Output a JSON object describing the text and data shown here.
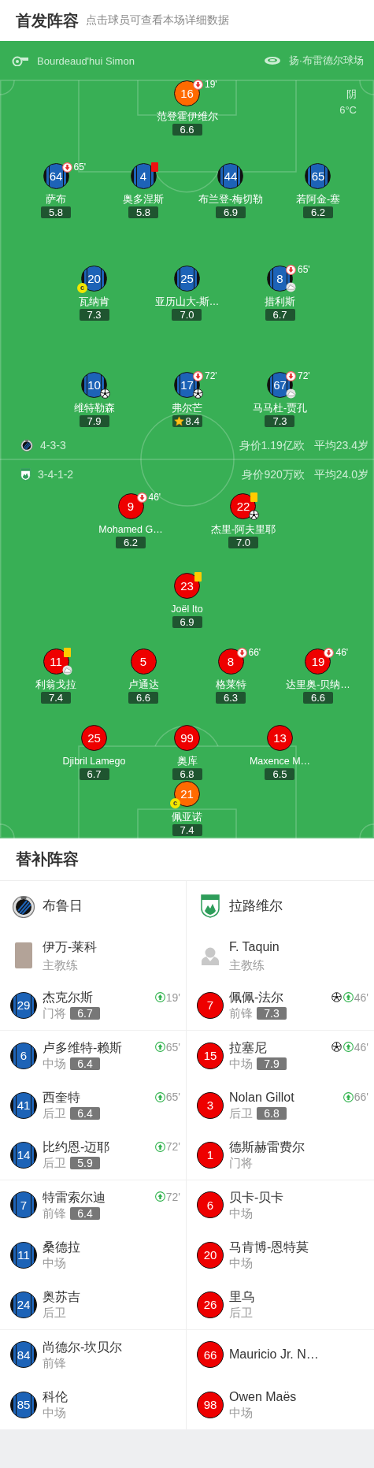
{
  "header": {
    "title": "首发阵容",
    "hint": "点击球员可查看本场详细数据"
  },
  "match_info": {
    "referee": "Bourdeaud'hui Simon",
    "stadium": "扬·布雷德尔球场",
    "weather": "阴",
    "temperature": "6°C"
  },
  "home": {
    "kind": "striped",
    "formation": "4-3-3",
    "market_value": "身价1.19亿欧",
    "average_age": "平均23.4岁",
    "goalkeeper": {
      "number": "16",
      "name": "范登霍伊维尔",
      "rating": "6.6",
      "mvp": false,
      "events": [
        {
          "kind": "sub_off",
          "minute": "19'"
        }
      ]
    },
    "lines": [
      [
        {
          "number": "64",
          "name": "萨布",
          "rating": "5.8",
          "mvp": false,
          "events": [
            {
              "kind": "sub_off",
              "minute": "65'"
            }
          ]
        },
        {
          "number": "4",
          "name": "奥多涅斯",
          "rating": "5.8",
          "mvp": false,
          "events": [
            {
              "kind": "red_card"
            }
          ]
        },
        {
          "number": "44",
          "name": "布兰登-梅切勒",
          "rating": "6.9",
          "mvp": false
        },
        {
          "number": "65",
          "name": "若阿金-塞",
          "rating": "6.2",
          "mvp": false
        }
      ],
      [
        {
          "number": "20",
          "name": "瓦纳肯",
          "rating": "7.3",
          "mvp": false,
          "events": [
            {
              "kind": "captain",
              "label": "c"
            }
          ]
        },
        {
          "number": "25",
          "name": "亚历山大-斯…",
          "rating": "7.0",
          "mvp": false
        },
        {
          "number": "8",
          "name": "措利斯",
          "rating": "6.7",
          "mvp": false,
          "events": [
            {
              "kind": "sub_off",
              "minute": "65'"
            },
            {
              "kind": "assist"
            }
          ]
        }
      ],
      [
        {
          "number": "10",
          "name": "维特勒森",
          "rating": "7.9",
          "mvp": false,
          "events": [
            {
              "kind": "goal"
            }
          ]
        },
        {
          "number": "17",
          "name": "弗尔芒",
          "rating": "8.4",
          "mvp": true,
          "events": [
            {
              "kind": "sub_off",
              "minute": "72'"
            },
            {
              "kind": "goal"
            }
          ]
        },
        {
          "number": "67",
          "name": "马马杜-贾孔",
          "rating": "7.3",
          "mvp": false,
          "events": [
            {
              "kind": "sub_off",
              "minute": "72'"
            },
            {
              "kind": "assist"
            }
          ]
        }
      ]
    ]
  },
  "away": {
    "kind": "solid",
    "formation": "3-4-1-2",
    "market_value": "身价920万欧",
    "average_age": "平均24.0岁",
    "lines": [
      [
        {
          "number": "9",
          "name": "Mohamed G…",
          "rating": "6.2",
          "mvp": false,
          "events": [
            {
              "kind": "sub_off",
              "minute": "46'"
            }
          ]
        },
        {
          "number": "22",
          "name": "杰里-阿夫里耶",
          "rating": "7.0",
          "mvp": false,
          "events": [
            {
              "kind": "yellow_card"
            },
            {
              "kind": "goal"
            }
          ]
        }
      ],
      [
        {
          "number": "23",
          "name": "Joël Ito",
          "rating": "6.9",
          "mvp": false,
          "events": [
            {
              "kind": "yellow_card"
            }
          ]
        }
      ],
      [
        {
          "number": "11",
          "name": "利翁戈拉",
          "rating": "7.4",
          "mvp": false,
          "events": [
            {
              "kind": "yellow_card"
            },
            {
              "kind": "assist"
            }
          ]
        },
        {
          "number": "5",
          "name": "卢通达",
          "rating": "6.6",
          "mvp": false
        },
        {
          "number": "8",
          "name": "格莱特",
          "rating": "6.3",
          "mvp": false,
          "events": [
            {
              "kind": "sub_off",
              "minute": "66'"
            }
          ]
        },
        {
          "number": "19",
          "name": "达里奥-贝纳…",
          "rating": "6.6",
          "mvp": false,
          "events": [
            {
              "kind": "sub_off",
              "minute": "46'"
            }
          ]
        }
      ],
      [
        {
          "number": "25",
          "name": "Djibril Lamego",
          "rating": "6.7",
          "mvp": false
        },
        {
          "number": "99",
          "name": "奥库",
          "rating": "6.8",
          "mvp": false
        },
        {
          "number": "13",
          "name": "Maxence M…",
          "rating": "6.5",
          "mvp": false
        }
      ]
    ],
    "goalkeeper": {
      "number": "21",
      "name": "佩亚诺",
      "rating": "7.4",
      "mvp": false,
      "events": [
        {
          "kind": "captain",
          "label": "c"
        }
      ]
    }
  },
  "bench": {
    "title": "替补阵容",
    "teams": [
      {
        "name": "布鲁日",
        "kind": "striped",
        "coach": {
          "kind": "photo",
          "name": "伊万-莱科",
          "role": "主教练"
        },
        "subs": [
          {
            "number": "29",
            "name": "杰克尔斯",
            "position": "门将",
            "rating": "6.7",
            "events": [
              {
                "kind": "sub_on",
                "minute": "19'"
              }
            ]
          },
          {
            "number": "6",
            "name": "卢多维特-赖斯",
            "position": "中场",
            "rating": "6.4",
            "events": [
              {
                "kind": "sub_on",
                "minute": "65'"
              }
            ]
          },
          {
            "number": "41",
            "name": "西奎特",
            "position": "后卫",
            "rating": "6.4",
            "events": [
              {
                "kind": "sub_on",
                "minute": "65'"
              }
            ]
          },
          {
            "number": "14",
            "name": "比约恩-迈耶",
            "position": "后卫",
            "rating": "5.9",
            "events": [
              {
                "kind": "sub_on",
                "minute": "72'"
              }
            ]
          },
          {
            "number": "7",
            "name": "特雷索尔迪",
            "position": "前锋",
            "rating": "6.4",
            "events": [
              {
                "kind": "sub_on",
                "minute": "72'"
              }
            ]
          },
          {
            "number": "11",
            "name": "桑德拉",
            "position": "中场"
          },
          {
            "number": "24",
            "name": "奥苏吉",
            "position": "后卫"
          },
          {
            "number": "84",
            "name": "尚德尔-坎贝尔",
            "position": "前锋"
          },
          {
            "number": "85",
            "name": "科伦",
            "position": "中场"
          }
        ]
      },
      {
        "name": "拉路维尔",
        "kind": "solid",
        "coach": {
          "kind": "silhouette",
          "name": "F. Taquin",
          "role": "主教练"
        },
        "subs": [
          {
            "number": "7",
            "name": "佩佩-法尔",
            "position": "前锋",
            "rating": "7.3",
            "events": [
              {
                "kind": "goal"
              },
              {
                "kind": "sub_on",
                "minute": "46'"
              }
            ]
          },
          {
            "number": "15",
            "name": "拉塞尼",
            "position": "中场",
            "rating": "7.9",
            "events": [
              {
                "kind": "goal"
              },
              {
                "kind": "sub_on",
                "minute": "46'"
              }
            ]
          },
          {
            "number": "3",
            "name": "Nolan Gillot",
            "position": "后卫",
            "rating": "6.8",
            "events": [
              {
                "kind": "sub_on",
                "minute": "66'"
              }
            ]
          },
          {
            "number": "1",
            "name": "德斯赫雷费尔",
            "position": "门将"
          },
          {
            "number": "6",
            "name": "贝卡-贝卡",
            "position": "中场"
          },
          {
            "number": "20",
            "name": "马肯博-恩特莫",
            "position": "中场"
          },
          {
            "number": "26",
            "name": "里乌",
            "position": "后卫"
          },
          {
            "number": "66",
            "name": "Mauricio Jr. N…"
          },
          {
            "number": "98",
            "name": "Owen Maës",
            "position": "中场"
          }
        ]
      }
    ]
  }
}
